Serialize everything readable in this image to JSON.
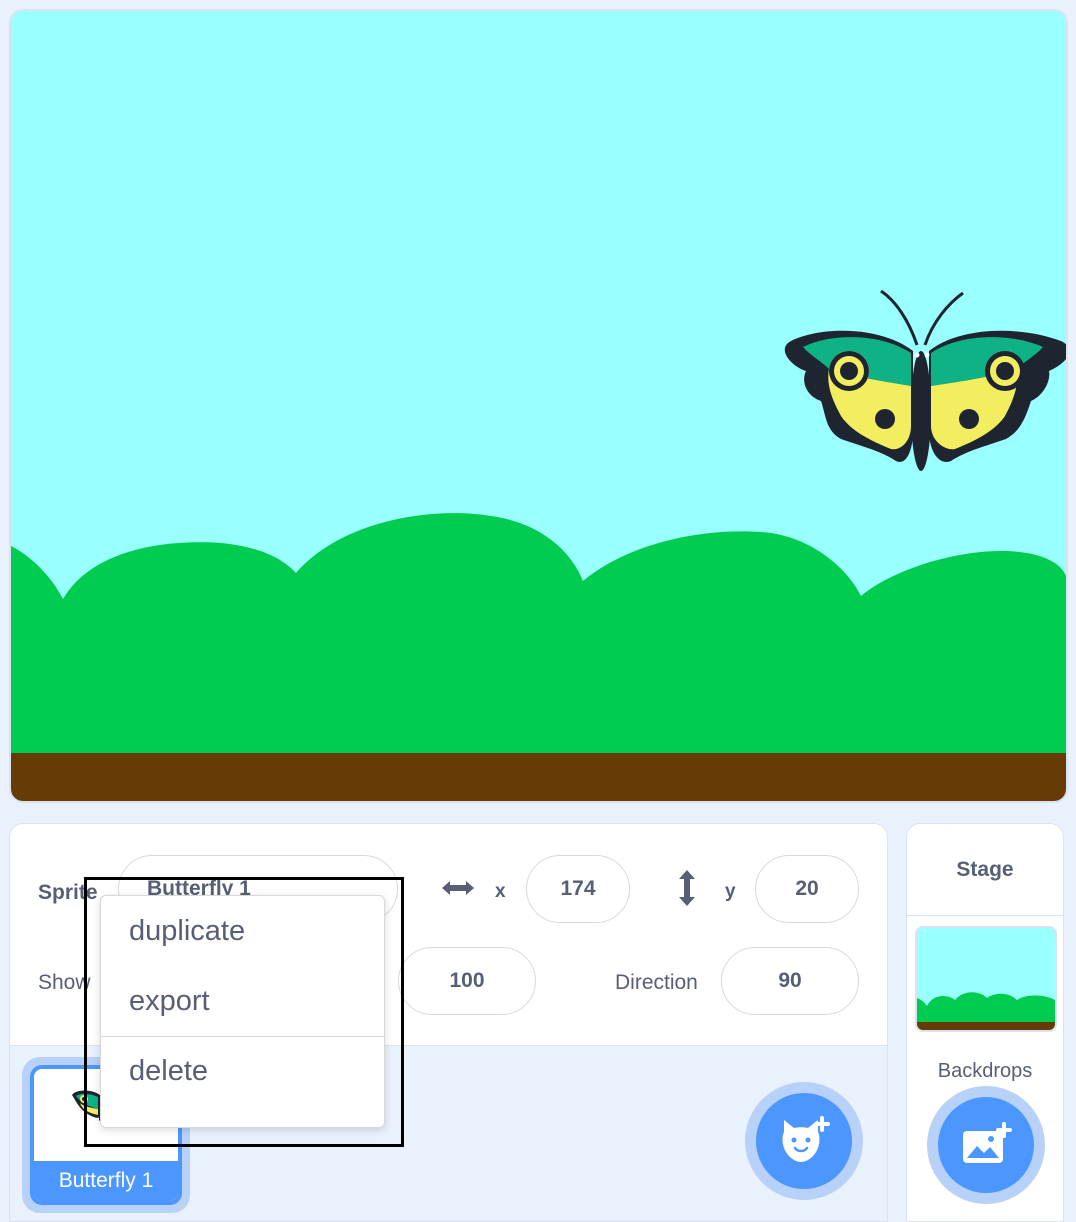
{
  "sprite_info": {
    "sprite_label": "Sprite",
    "sprite_name": "Butterfly 1",
    "x_label": "x",
    "x_value": "174",
    "y_label": "y",
    "y_value": "20",
    "show_label": "Show",
    "size_value": "100",
    "direction_label": "Direction",
    "direction_value": "90"
  },
  "sprite_list": {
    "items": [
      {
        "name": "Butterfly 1",
        "selected": true
      }
    ]
  },
  "context_menu": {
    "items": [
      {
        "label": "duplicate"
      },
      {
        "label": "export"
      },
      {
        "label": "delete"
      }
    ]
  },
  "stage_panel": {
    "title": "Stage",
    "backdrops_label": "Backdrops"
  },
  "icons": {
    "x_axis": "horizontal-arrows-icon",
    "y_axis": "vertical-arrows-icon",
    "add_sprite": "cat-plus-icon",
    "add_backdrop": "image-plus-icon"
  },
  "colors": {
    "accent": "#4c97ff",
    "sky": "#99ffff",
    "grass": "#00cc4f",
    "ground": "#663b06",
    "text": "#575e75"
  }
}
